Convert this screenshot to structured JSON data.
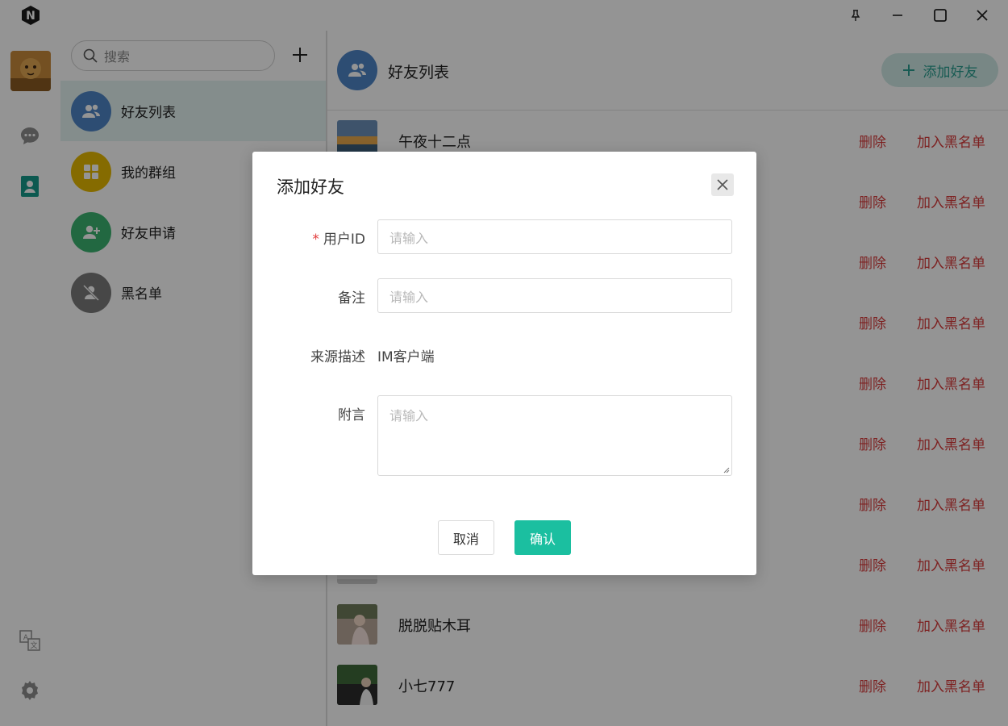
{
  "window": {
    "controls": [
      "pin-icon",
      "minimize-icon",
      "maximize-icon",
      "close-icon"
    ]
  },
  "rail": {
    "items": [
      {
        "icon": "chat-icon",
        "active": false
      },
      {
        "icon": "contacts-icon",
        "active": true
      }
    ],
    "bottom": [
      "translate-icon",
      "settings-icon"
    ]
  },
  "search": {
    "placeholder": "搜索"
  },
  "nav": {
    "items": [
      {
        "label": "好友列表",
        "icon": "friends-icon",
        "color": "#4f86c6",
        "active": true
      },
      {
        "label": "我的群组",
        "icon": "group-icon",
        "color": "#e6b800",
        "active": false
      },
      {
        "label": "好友申请",
        "icon": "add-user-icon",
        "color": "#3cb371",
        "active": false
      },
      {
        "label": "黑名单",
        "icon": "blocked-user-icon",
        "color": "#7a7a7a",
        "active": false
      }
    ]
  },
  "header": {
    "title": "好友列表",
    "add_button": "添加好友"
  },
  "friends": [
    {
      "name": "午夜十二点",
      "delete": "删除",
      "blacklist": "加入黑名单"
    },
    {
      "name": "",
      "delete": "删除",
      "blacklist": "加入黑名单"
    },
    {
      "name": "",
      "delete": "删除",
      "blacklist": "加入黑名单"
    },
    {
      "name": "",
      "delete": "删除",
      "blacklist": "加入黑名单"
    },
    {
      "name": "",
      "delete": "删除",
      "blacklist": "加入黑名单"
    },
    {
      "name": "",
      "delete": "删除",
      "blacklist": "加入黑名单"
    },
    {
      "name": "",
      "delete": "删除",
      "blacklist": "加入黑名单"
    },
    {
      "name": "",
      "delete": "删除",
      "blacklist": "加入黑名单"
    },
    {
      "name": "脱脱贴木耳",
      "delete": "删除",
      "blacklist": "加入黑名单"
    },
    {
      "name": "小七777",
      "delete": "删除",
      "blacklist": "加入黑名单"
    }
  ],
  "dialog": {
    "title": "添加好友",
    "user_id_label": "用户ID",
    "user_id_placeholder": "请输入",
    "remark_label": "备注",
    "remark_placeholder": "请输入",
    "source_label": "来源描述",
    "source_value": "IM客户端",
    "message_label": "附言",
    "message_placeholder": "请输入",
    "cancel": "取消",
    "confirm": "确认"
  },
  "colors": {
    "accent": "#1bbfa0",
    "danger": "#d83a3a",
    "active_nav_bg": "#e4f3f2"
  }
}
